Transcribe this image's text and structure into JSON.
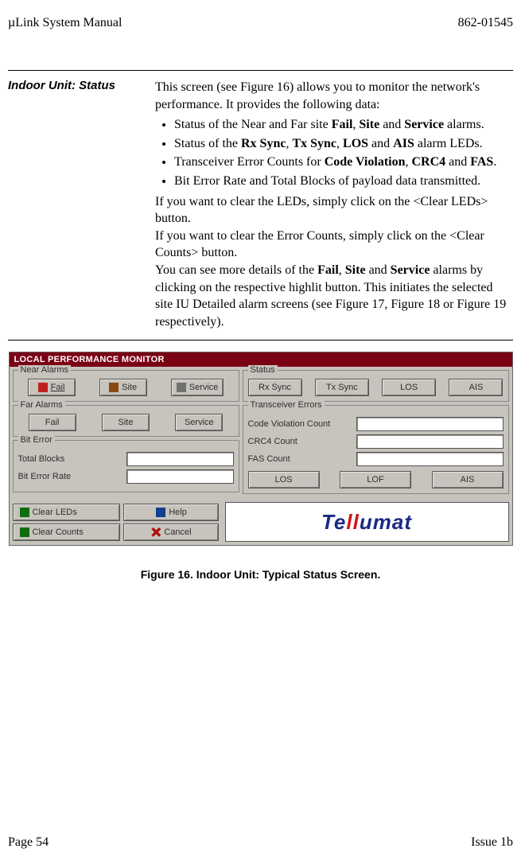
{
  "header": {
    "left": "µLink System Manual",
    "right": "862-01545"
  },
  "section": {
    "sidebar": "Indoor Unit: Status",
    "intro": "This screen (see Figure 16) allows you to monitor the network's performance.  It provides the following data:",
    "bullets": [
      {
        "pre": "Status of the Near and Far site ",
        "b1": "Fail",
        "mid1": ", ",
        "b2": "Site",
        "mid2": " and ",
        "b3": "Service",
        "post": " alarms."
      },
      {
        "pre": "Status of the ",
        "b1": "Rx Sync",
        "mid1": ", ",
        "b2": "Tx Sync",
        "mid2": ", ",
        "b3": "LOS",
        "mid3": " and ",
        "b4": "AIS",
        "post": " alarm LEDs."
      },
      {
        "pre": "Transceiver Error Counts for ",
        "b1": "Code Violation",
        "mid1": ", ",
        "b2": "CRC4",
        "mid2": " and ",
        "b3": "FAS",
        "post": "."
      },
      {
        "plain": "Bit Error Rate and Total Blocks of payload data transmitted."
      }
    ],
    "p2": "If you want to clear the LEDs, simply click on the <Clear LEDs> button.",
    "p3": "If you want to clear the Error Counts, simply click on the <Clear Counts> button.",
    "p4a": "You can see more details of the ",
    "p4b1": "Fail",
    "p4m1": ", ",
    "p4b2": "Site",
    "p4m2": " and ",
    "p4b3": "Service",
    "p4c": " alarms by clicking on the respective highlit button. This initiates the selected site IU Detailed alarm screens (see Figure 17, Figure 18 or Figure 19 respectively)."
  },
  "window": {
    "title": "LOCAL PERFORMANCE MONITOR",
    "near_alarms": {
      "title": "Near Alarms",
      "fail": "Fail",
      "site": "Site",
      "service": "Service"
    },
    "far_alarms": {
      "title": "Far Alarms",
      "fail": "Fail",
      "site": "Site",
      "service": "Service"
    },
    "bit_error": {
      "title": "Bit Error",
      "total_blocks": "Total Blocks",
      "ber": "Bit Error Rate"
    },
    "status": {
      "title": "Status",
      "rx": "Rx Sync",
      "tx": "Tx Sync",
      "los": "LOS",
      "ais": "AIS"
    },
    "trans_errors": {
      "title": "Transceiver Errors",
      "cvc": "Code Violation Count",
      "crc4": "CRC4 Count",
      "fas": "FAS Count",
      "los": "LOS",
      "lof": "LOF",
      "ais": "AIS"
    },
    "bottom": {
      "clear_leds": "Clear LEDs",
      "clear_counts": "Clear Counts",
      "help": "Help",
      "cancel": "Cancel",
      "logo_a": "Te",
      "logo_b": "ll",
      "logo_c": "umat"
    }
  },
  "figure_caption": "Figure 16.  Indoor Unit:  Typical Status Screen.",
  "footer": {
    "left": "Page 54",
    "right": "Issue 1b"
  }
}
